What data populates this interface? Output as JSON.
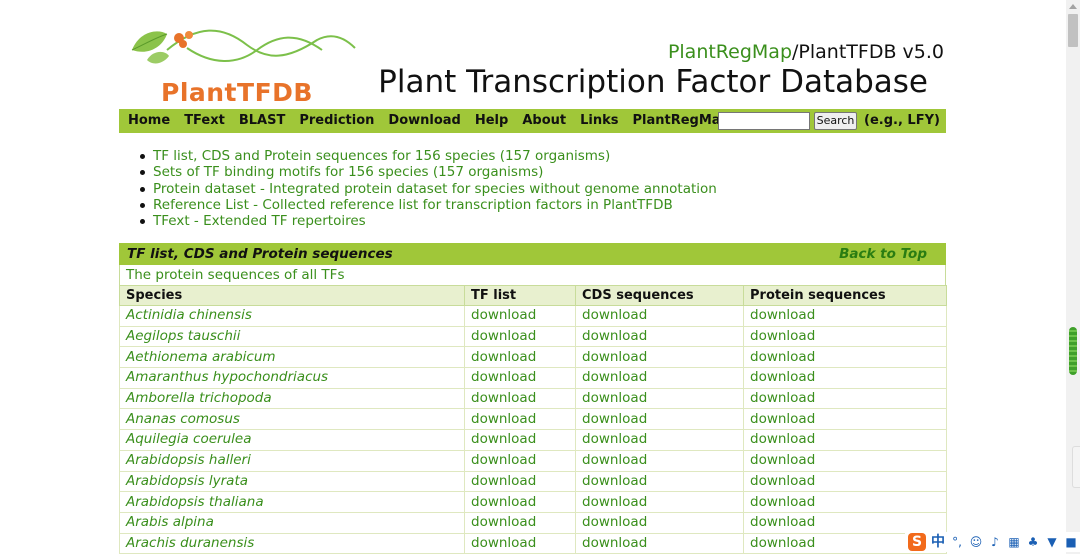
{
  "brand": {
    "logo_text": "PlantTFDB",
    "regmap": "PlantRegMap",
    "rest": "/PlantTFDB v5.0",
    "title": "Plant Transcription Factor Database"
  },
  "nav": {
    "items": [
      "Home",
      "TFext",
      "BLAST",
      "Prediction",
      "Download",
      "Help",
      "About",
      "Links",
      "PlantRegMap"
    ],
    "search_value": "",
    "search_button": "Search",
    "search_hint": "(e.g.,  LFY)"
  },
  "bullets": [
    "TF list, CDS and Protein sequences for 156 species (157 organisms)",
    "Sets of TF binding motifs for 156 species (157 organisms)",
    "Protein dataset - Integrated protein dataset for species without genome annotation",
    "Reference List - Collected reference list for transcription factors in PlantTFDB",
    "TFext - Extended TF repertoires"
  ],
  "section": {
    "title": "TF list, CDS and Protein sequences",
    "back_to_top": "Back to Top",
    "description": "The protein sequences of all TFs",
    "columns": [
      "Species",
      "TF list",
      "CDS sequences",
      "Protein sequences"
    ],
    "link_label": "download",
    "rows": [
      "Actinidia chinensis",
      "Aegilops tauschii",
      "Aethionema arabicum",
      "Amaranthus hypochondriacus",
      "Amborella trichopoda",
      "Ananas comosus",
      "Aquilegia coerulea",
      "Arabidopsis halleri",
      "Arabidopsis lyrata",
      "Arabidopsis thaliana",
      "Arabis alpina",
      "Arachis duranensis"
    ]
  },
  "ime": {
    "logo": "S",
    "lang": "中",
    "icons": [
      "punctuation-icon",
      "emoji-icon",
      "microphone-icon",
      "keyboard-icon",
      "skin-icon",
      "shirt-icon",
      "grid-icon"
    ]
  },
  "colors": {
    "accent_green": "#a0c739",
    "link_green": "#3a8f1c",
    "logo_orange": "#e8732a"
  }
}
